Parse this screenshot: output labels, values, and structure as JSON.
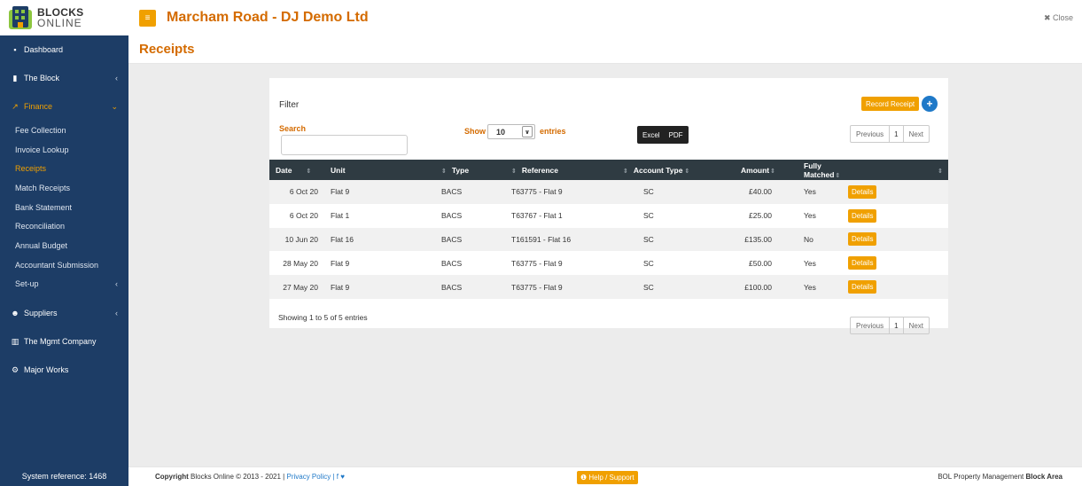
{
  "logo": {
    "line1": "BLOCKS",
    "line2": "ONLINE"
  },
  "header": {
    "menu_icon": "≡",
    "property_title": "Marcham Road - DJ Demo Ltd",
    "close_label": "✖ Close"
  },
  "page_title": "Receipts",
  "sidebar": {
    "items": [
      {
        "icon": "▪",
        "label": "Dashboard"
      },
      {
        "icon": "▮",
        "label": "The Block",
        "chevron": "‹"
      },
      {
        "icon": "↗",
        "label": "Finance",
        "chevron": "⌄"
      }
    ],
    "finance_sub": [
      "Fee Collection",
      "Invoice Lookup",
      "Receipts",
      "Match Receipts",
      "Bank Statement",
      "Reconciliation",
      "Annual Budget",
      "Accountant Submission",
      "Set-up"
    ],
    "setup_chevron": "‹",
    "items_after": [
      {
        "icon": "☻",
        "label": "Suppliers",
        "chevron": "‹"
      },
      {
        "icon": "▥",
        "label": "The Mgmt Company"
      },
      {
        "icon": "⚙",
        "label": "Major Works"
      }
    ],
    "system_reference": "System reference: 1468"
  },
  "panel": {
    "filter_label": "Filter",
    "record_receipt": "Record Receipt",
    "plus": "+",
    "search_label": "Search",
    "search_value": "",
    "show_label": "Show",
    "entries_value": "10",
    "entries_label": "entries",
    "export": {
      "excel": "Excel",
      "pdf": "PDF"
    },
    "pager": {
      "previous": "Previous",
      "page": "1",
      "next": "Next"
    },
    "showing": "Showing 1 to 5 of 5 entries"
  },
  "table": {
    "headers": [
      "Date",
      "Unit",
      "Type",
      "Reference",
      "Account Type",
      "Amount",
      "Fully Matched",
      ""
    ],
    "rows": [
      {
        "date": "6 Oct 20",
        "unit": "Flat 9",
        "type": "BACS",
        "reference": "T63775 - Flat 9",
        "account_type": "SC",
        "amount": "£40.00",
        "matched": "Yes",
        "action": "Details"
      },
      {
        "date": "6 Oct 20",
        "unit": "Flat 1",
        "type": "BACS",
        "reference": "T63767 - Flat 1",
        "account_type": "SC",
        "amount": "£25.00",
        "matched": "Yes",
        "action": "Details"
      },
      {
        "date": "10 Jun 20",
        "unit": "Flat 16",
        "type": "BACS",
        "reference": "T161591 - Flat 16",
        "account_type": "SC",
        "amount": "£135.00",
        "matched": "No",
        "action": "Details"
      },
      {
        "date": "28 May 20",
        "unit": "Flat 9",
        "type": "BACS",
        "reference": "T63775 - Flat 9",
        "account_type": "SC",
        "amount": "£50.00",
        "matched": "Yes",
        "action": "Details"
      },
      {
        "date": "27 May 20",
        "unit": "Flat 9",
        "type": "BACS",
        "reference": "T63775 - Flat 9",
        "account_type": "SC",
        "amount": "£100.00",
        "matched": "Yes",
        "action": "Details"
      }
    ]
  },
  "footer": {
    "copyright_bold": "Copyright",
    "copyright_text": " Blocks Online © 2013 - 2021 | ",
    "privacy": "Privacy Policy",
    "social": " | f ♥",
    "help": "❶ Help / Support",
    "bol_text": "BOL Property Management ",
    "bol_bold": "Block Area"
  },
  "colors": {
    "sidebar": "#1d3d66",
    "accent": "#f0a000",
    "title": "#d46b00",
    "table_header": "#2f3b42",
    "link": "#1f79c8"
  }
}
